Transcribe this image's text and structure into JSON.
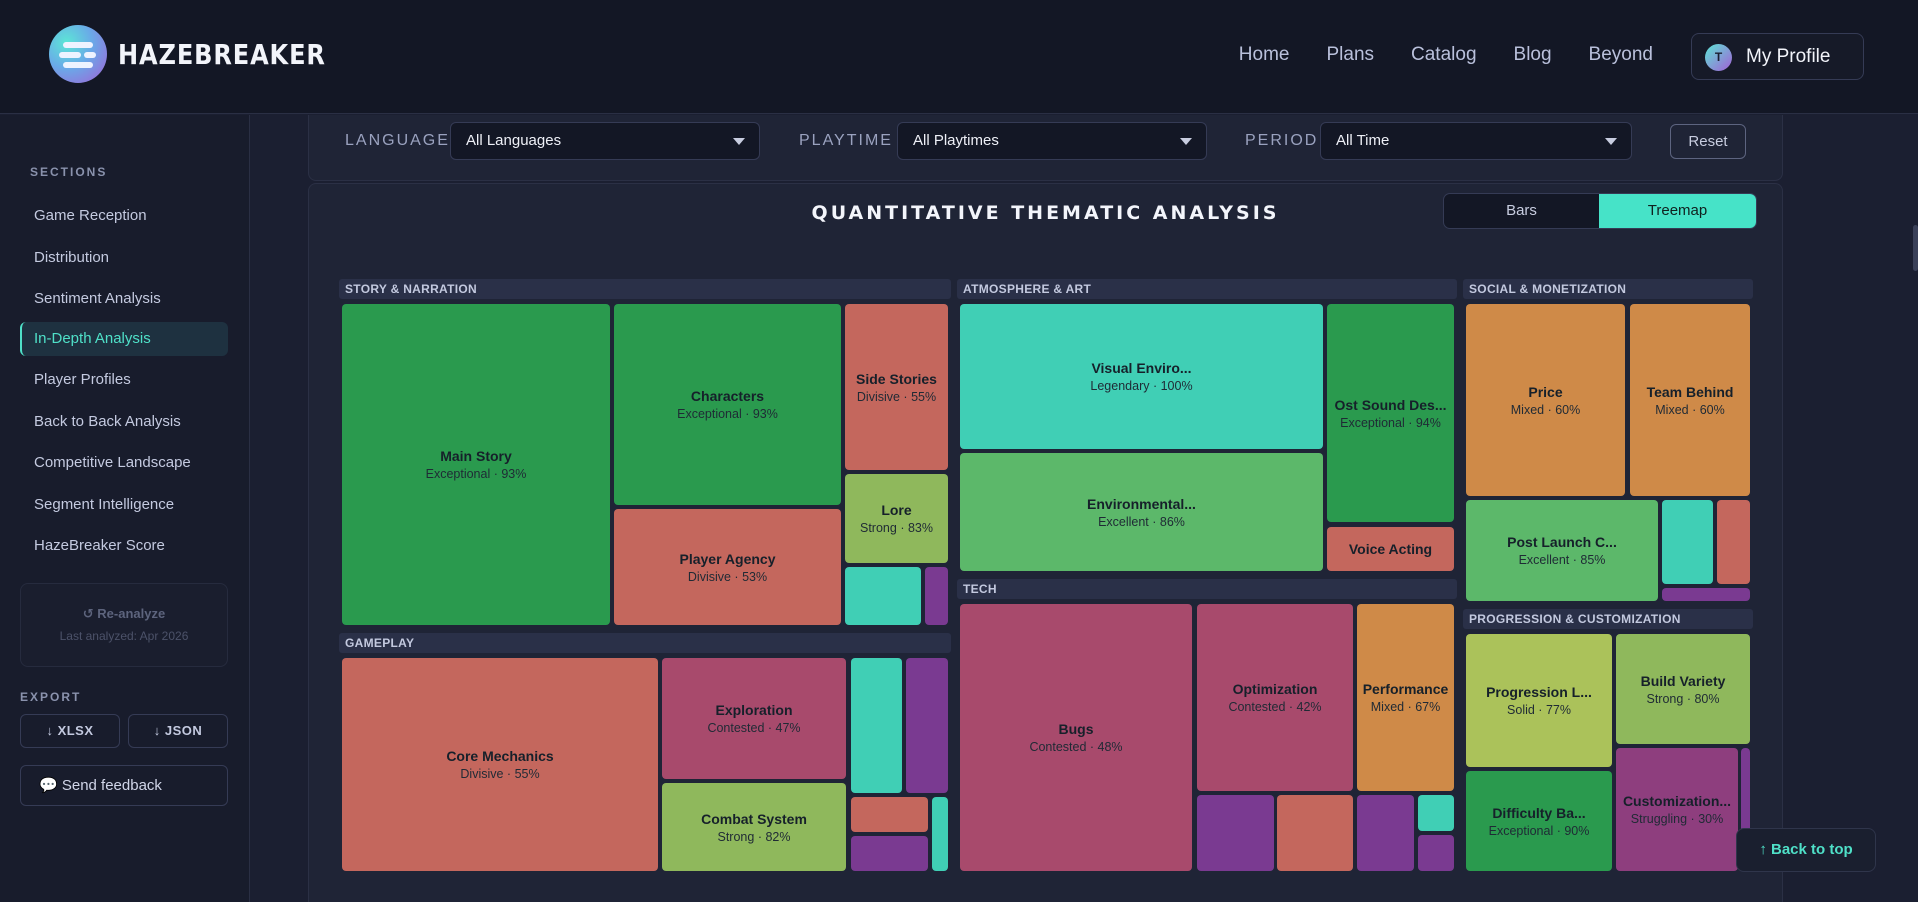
{
  "nav": {
    "brand": "HAZEBREAKER",
    "links": [
      "Home",
      "Plans",
      "Catalog",
      "Blog",
      "Beyond"
    ],
    "profile_label": "My Profile",
    "profile_initial": "T"
  },
  "sidebar": {
    "sections_title": "SECTIONS",
    "items": [
      {
        "label": "Game Reception",
        "active": false
      },
      {
        "label": "Distribution",
        "active": false
      },
      {
        "label": "Sentiment Analysis",
        "active": false
      },
      {
        "label": "In-Depth Analysis",
        "active": true
      },
      {
        "label": "Player Profiles",
        "active": false
      },
      {
        "label": "Back to Back Analysis",
        "active": false
      },
      {
        "label": "Competitive Landscape",
        "active": false
      },
      {
        "label": "Segment Intelligence",
        "active": false
      },
      {
        "label": "HazeBreaker Score",
        "active": false
      }
    ],
    "reanalyze_label": "↺ Re-analyze",
    "last_analyzed": "Last analyzed: Apr 2026",
    "export_title": "EXPORT",
    "export_xlsx": "↓ XLSX",
    "export_json": "↓ JSON",
    "feedback_label": "💬 Send feedback"
  },
  "filters": {
    "language_label": "LANGUAGE",
    "language_value": "All Languages",
    "playtime_label": "PLAYTIME",
    "playtime_value": "All Playtimes",
    "period_label": "PERIOD",
    "period_value": "All Time",
    "reset_label": "Reset"
  },
  "analysis": {
    "title": "QUANTITATIVE THEMATIC ANALYSIS",
    "view_bars": "Bars",
    "view_treemap": "Treemap",
    "active_view": "Treemap"
  },
  "treemap": {
    "groups": [
      {
        "id": "story",
        "label": "STORY & NARRATION"
      },
      {
        "id": "atmo",
        "label": "ATMOSPHERE & ART"
      },
      {
        "id": "social",
        "label": "SOCIAL & MONETIZATION"
      },
      {
        "id": "gameplay",
        "label": "GAMEPLAY"
      },
      {
        "id": "tech",
        "label": "TECH"
      },
      {
        "id": "prog",
        "label": "PROGRESSION & CUSTOMIZATION"
      }
    ],
    "tiles": [
      {
        "name": "Main Story",
        "rating": "Exceptional",
        "score": "93%",
        "color": "#2a9a4e"
      },
      {
        "name": "Characters",
        "rating": "Exceptional",
        "score": "93%",
        "color": "#2a9a4e"
      },
      {
        "name": "Side Stories",
        "rating": "Divisive",
        "score": "55%",
        "color": "#c4675d"
      },
      {
        "name": "Lore",
        "rating": "Strong",
        "score": "83%",
        "color": "#8fb85c"
      },
      {
        "name": "Player Agency",
        "rating": "Divisive",
        "score": "53%",
        "color": "#c4675d"
      },
      {
        "name": "Visual Enviro...",
        "rating": "Legendary",
        "score": "100%",
        "color": "#40cfb5"
      },
      {
        "name": "Ost Sound Des...",
        "rating": "Exceptional",
        "score": "94%",
        "color": "#2a9a4e"
      },
      {
        "name": "Environmental...",
        "rating": "Excellent",
        "score": "86%",
        "color": "#5cb86a"
      },
      {
        "name": "Voice Acting",
        "rating": "",
        "score": "",
        "color": "#c4675d"
      },
      {
        "name": "Price",
        "rating": "Mixed",
        "score": "60%",
        "color": "#cf8a48"
      },
      {
        "name": "Team Behind",
        "rating": "Mixed",
        "score": "60%",
        "color": "#cf8a48"
      },
      {
        "name": "Post Launch C...",
        "rating": "Excellent",
        "score": "85%",
        "color": "#5cb86a"
      },
      {
        "name": "Core Mechanics",
        "rating": "Divisive",
        "score": "55%",
        "color": "#c4675d"
      },
      {
        "name": "Exploration",
        "rating": "Contested",
        "score": "47%",
        "color": "#a84a6c"
      },
      {
        "name": "Combat System",
        "rating": "Strong",
        "score": "82%",
        "color": "#8fb85c"
      },
      {
        "name": "Bugs",
        "rating": "Contested",
        "score": "48%",
        "color": "#a84a6c"
      },
      {
        "name": "Optimization",
        "rating": "Contested",
        "score": "42%",
        "color": "#a84a6c"
      },
      {
        "name": "Performance",
        "rating": "Mixed",
        "score": "67%",
        "color": "#cf8a48"
      },
      {
        "name": "Progression L...",
        "rating": "Solid",
        "score": "77%",
        "color": "#abc25a"
      },
      {
        "name": "Build Variety",
        "rating": "Strong",
        "score": "80%",
        "color": "#8fb85c"
      },
      {
        "name": "Difficulty Ba...",
        "rating": "Exceptional",
        "score": "90%",
        "color": "#2a9a4e"
      },
      {
        "name": "Customization...",
        "rating": "Struggling",
        "score": "30%",
        "color": "#8e3e7e"
      }
    ]
  },
  "back_to_top": "↑ Back to top"
}
